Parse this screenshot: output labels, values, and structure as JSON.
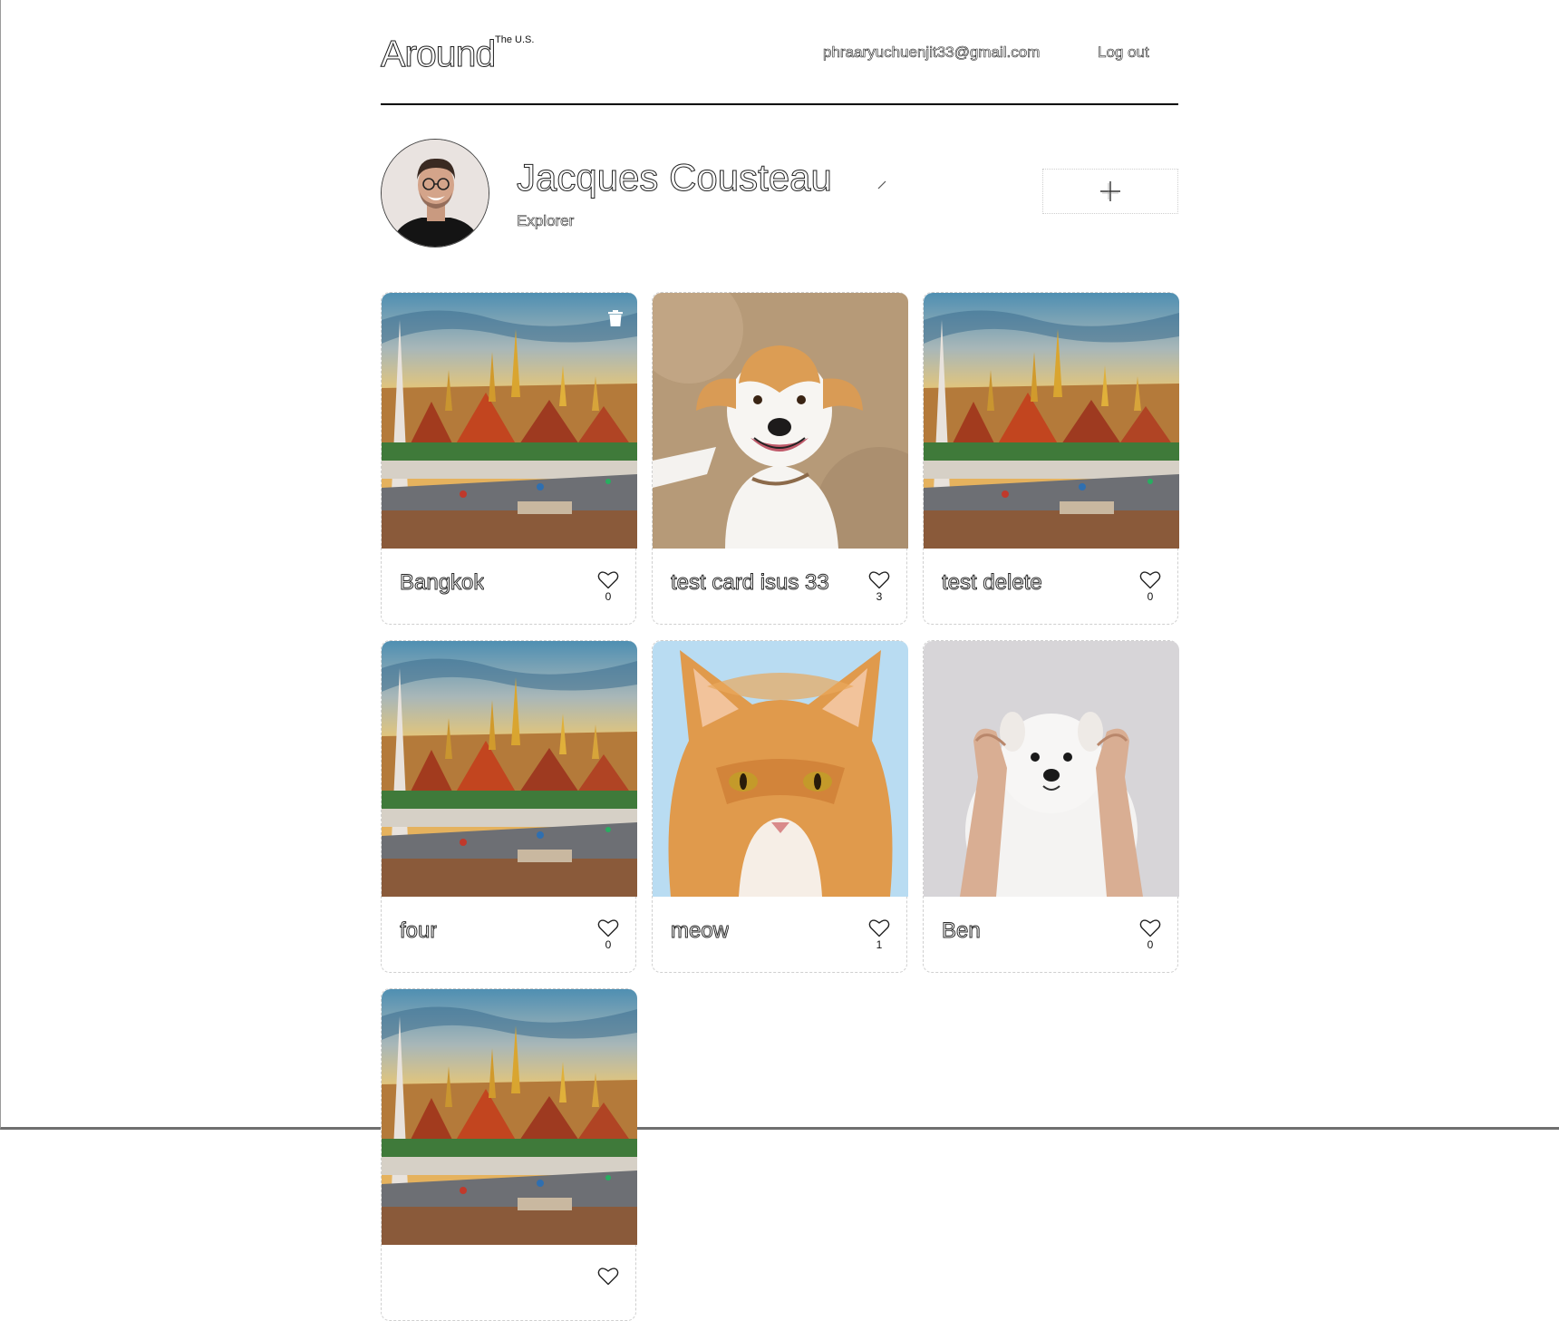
{
  "header": {
    "logo": "Around",
    "logo_sup": "The U.S.",
    "email": "phraaryuchuenjit33@gmail.com",
    "logout_label": "Log out"
  },
  "profile": {
    "name": "Jacques Cousteau",
    "about": "Explorer"
  },
  "cards": [
    {
      "title": "Bangkok",
      "likes": "0",
      "image": "bangkok-temple-photo"
    },
    {
      "title": "test card isus 33",
      "likes": "3",
      "image": "smiling-dog-photo"
    },
    {
      "title": "test delete",
      "likes": "0",
      "image": "bangkok-temple-photo"
    },
    {
      "title": "four",
      "likes": "0",
      "image": "bangkok-temple-photo"
    },
    {
      "title": "meow",
      "likes": "1",
      "image": "orange-cat-photo"
    },
    {
      "title": "Ben",
      "likes": "0",
      "image": "white-puppy-photo"
    },
    {
      "title": "",
      "likes": "",
      "image": "bangkok-temple-photo"
    }
  ],
  "icons": {
    "edit": "pencil-icon",
    "add": "plus-icon",
    "delete": "trash-icon",
    "like": "heart-icon"
  }
}
